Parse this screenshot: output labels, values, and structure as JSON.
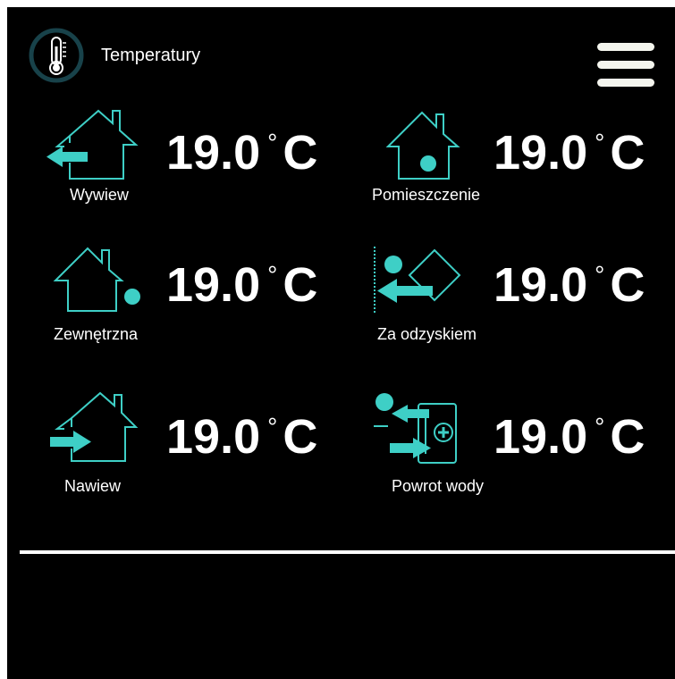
{
  "header": {
    "title": "Temperatury",
    "icon": "thermometer-icon",
    "menu_icon": "hamburger-menu-icon"
  },
  "colors": {
    "background": "#000000",
    "accent": "#3ecfc6",
    "icon_ring": "#18424a",
    "text": "#ffffff"
  },
  "sensors": [
    {
      "label": "Wywiew",
      "value": "19.0",
      "deg": "°",
      "unit": "C",
      "icon": "house-arrow-out-icon"
    },
    {
      "label": "Pomieszczenie",
      "value": "19.0",
      "deg": "°",
      "unit": "C",
      "icon": "house-room-icon"
    },
    {
      "label": "Zewnętrzna",
      "value": "19.0",
      "deg": "°",
      "unit": "C",
      "icon": "house-outside-icon"
    },
    {
      "label": "Za odzyskiem",
      "value": "19.0",
      "deg": "°",
      "unit": "C",
      "icon": "heat-recovery-icon"
    },
    {
      "label": "Nawiew",
      "value": "19.0",
      "deg": "°",
      "unit": "C",
      "icon": "house-arrow-in-icon"
    },
    {
      "label": "Powrot wody",
      "value": "19.0",
      "deg": "°",
      "unit": "C",
      "icon": "water-return-icon"
    }
  ]
}
